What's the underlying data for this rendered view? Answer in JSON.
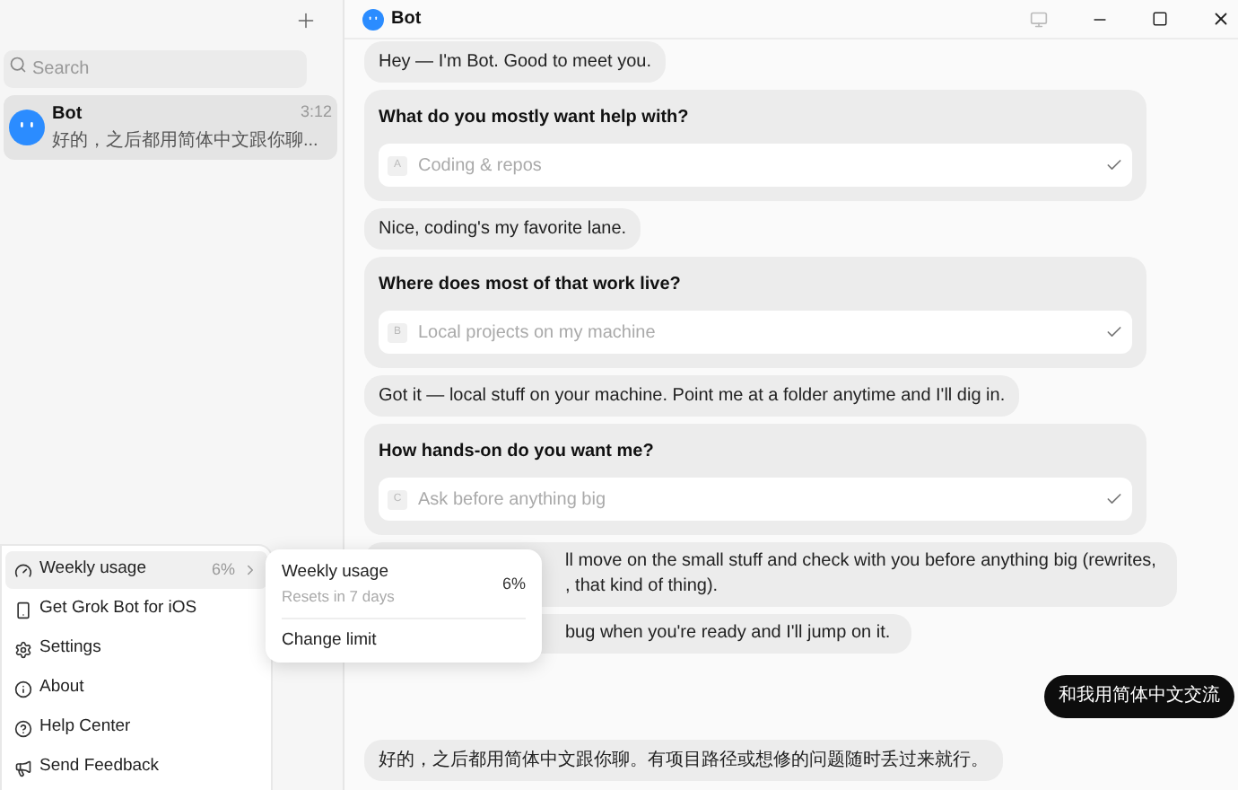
{
  "sidebar": {
    "search": {
      "placeholder": "Search"
    },
    "conversations": [
      {
        "name": "Bot",
        "time": "3:12",
        "preview": "好的，之后都用简体中文跟你聊...",
        "selected": true
      }
    ]
  },
  "menu": {
    "items": [
      {
        "kind": "usage",
        "label": "Weekly usage",
        "value": "6%",
        "selected": true
      },
      {
        "kind": "link",
        "label": "Get Grok Bot for iOS",
        "selected": false
      },
      {
        "kind": "link",
        "label": "Settings",
        "selected": false
      },
      {
        "kind": "link",
        "label": "About",
        "selected": false
      },
      {
        "kind": "link",
        "label": "Help Center",
        "selected": false
      },
      {
        "kind": "link",
        "label": "Send Feedback",
        "selected": false
      }
    ]
  },
  "usage_popup": {
    "title": "Weekly usage",
    "subtitle": "Resets in 7 days",
    "value": "6%",
    "action": "Change limit"
  },
  "header": {
    "title": "Bot"
  },
  "messages": [
    {
      "kind": "bot",
      "text": "Hey — I'm Bot. Good to meet you."
    },
    {
      "kind": "question",
      "question": "What do you mostly want help with?",
      "letter": "A",
      "answer": "Coding & repos",
      "answered": true
    },
    {
      "kind": "bot",
      "text": "Nice, coding's my favorite lane."
    },
    {
      "kind": "question",
      "question": "Where does most of that work live?",
      "letter": "B",
      "answer": "Local projects on my machine",
      "answered": true
    },
    {
      "kind": "bot",
      "text": "Got it — local stuff on your machine. Point me at a folder anytime and I'll dig in."
    },
    {
      "kind": "question",
      "question": "How hands-on do you want me?",
      "letter": "C",
      "answer": "Ask before anything big",
      "answered": true
    },
    {
      "kind": "covered",
      "lines": [
        "ll move on the small stuff and check with you before anything big (rewrites,",
        ", that kind of thing)."
      ]
    },
    {
      "kind": "covered",
      "lines": [
        "bug when you're ready and I'll jump on it."
      ]
    },
    {
      "kind": "user",
      "text": "和我用简体中文交流"
    },
    {
      "kind": "bot",
      "text": "好的，之后都用简体中文跟你聊。有项目路径或想修的问题随时丢过来就行。"
    }
  ]
}
